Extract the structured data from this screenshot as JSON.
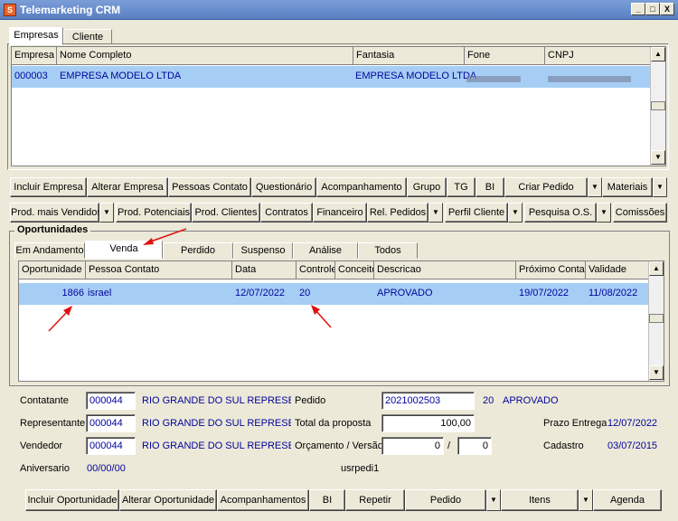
{
  "window": {
    "title": "Telemarketing CRM",
    "min": "_",
    "max": "□",
    "close": "X"
  },
  "top_tabs": [
    {
      "label": "Empresas"
    },
    {
      "label": "Cliente"
    }
  ],
  "companies_grid": {
    "headers": [
      "Empresa",
      "Nome Completo",
      "Fantasia",
      "Fone",
      "CNPJ"
    ],
    "rows": [
      {
        "code": "000003",
        "name": "EMPRESA MODELO LTDA",
        "fantasia": "EMPRESA MODELO LTDA"
      }
    ]
  },
  "toolbar1": [
    "Incluir Empresa",
    "Alterar Empresa",
    "Pessoas Contato",
    "Questionário",
    "Acompanhamento",
    "Grupo",
    "TG",
    "BI",
    "Criar Pedido",
    "Materiais"
  ],
  "toolbar2": [
    "Prod. mais Vendidos",
    "Prod. Potenciais",
    "Prod. Clientes",
    "Contratos",
    "Financeiro",
    "Rel. Pedidos",
    "Perfil Cliente",
    "Pesquisa O.S.",
    "Comissões"
  ],
  "opportunities": {
    "group_title": "Oportunidades",
    "tabs": [
      "Em Andamento",
      "Venda",
      "Perdido",
      "Suspenso",
      "Análise",
      "Todos"
    ],
    "headers": [
      "Oportunidade",
      "Pessoa Contato",
      "Data",
      "Controle",
      "Conceito",
      "Descricao",
      "Próximo Contato",
      "Validade"
    ],
    "rows": [
      {
        "id": "1866",
        "contact": "israel",
        "date": "12/07/2022",
        "control": "20",
        "concept": "",
        "description": "APROVADO",
        "next": "19/07/2022",
        "validity": "11/08/2022"
      }
    ]
  },
  "form": {
    "contratante_label": "Contatante",
    "contratante_code": "000044",
    "contratante_name": "RIO GRANDE DO SUL REPRESENTAN",
    "representante_label": "Representante",
    "representante_code": "000044",
    "representante_name": "RIO GRANDE DO SUL REPRESENTAN",
    "vendedor_label": "Vendedor",
    "vendedor_code": "000044",
    "vendedor_name": "RIO GRANDE DO SUL REPRESENTAN",
    "aniversario_label": "Aniversario",
    "aniversario_value": "00/00/00",
    "pedido_label": "Pedido",
    "pedido_value": "2021002503",
    "pedido_ctrl": "20",
    "pedido_status": "APROVADO",
    "total_label": "Total da proposta",
    "total_value": "100,00",
    "orcamento_label": "Orçamento / Versão",
    "orcamento_value": "0",
    "versao_sep": "/",
    "versao_value": "0",
    "user_value": "usrpedi1",
    "prazo_label": "Prazo Entrega",
    "prazo_value": "12/07/2022",
    "cadastro_label": "Cadastro",
    "cadastro_value": "03/07/2015"
  },
  "bottom_buttons": [
    "Incluir Oportunidade",
    "Alterar Oportunidade",
    "Acompanhamentos",
    "BI",
    "Repetir",
    "Pedido",
    "Itens",
    "Agenda"
  ],
  "colors": {
    "accent": "#02049c",
    "selection": "#a6cef5",
    "arrow": "#e01010"
  }
}
